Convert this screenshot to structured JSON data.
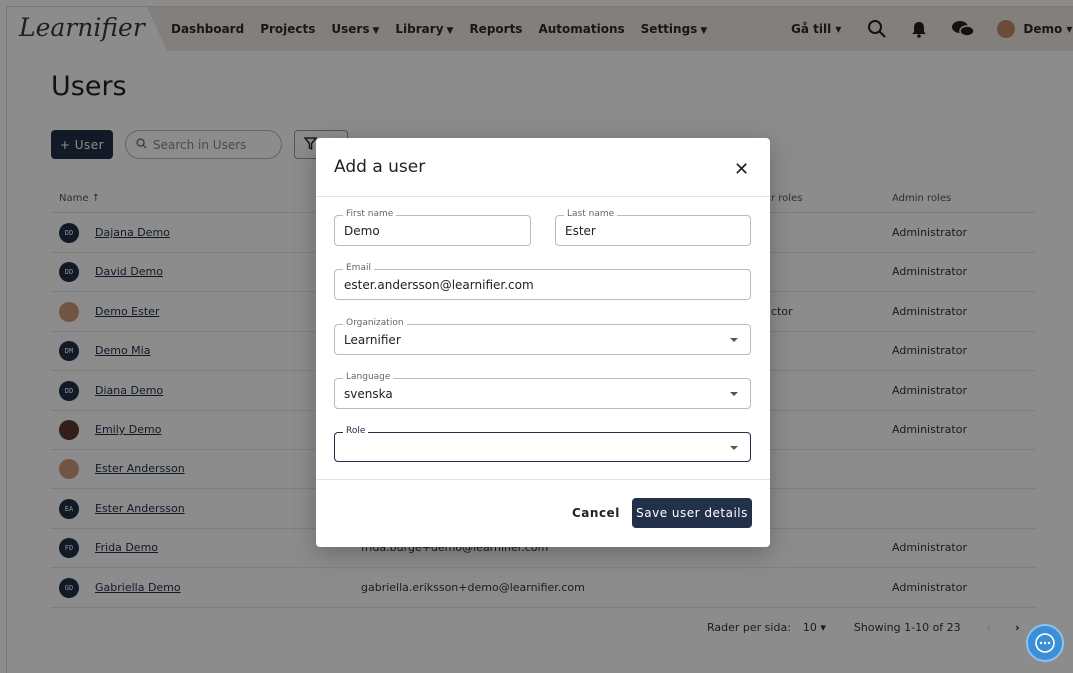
{
  "nav": {
    "logo": "Learnifier",
    "menu": [
      {
        "label": "Dashboard",
        "caret": false
      },
      {
        "label": "Projects",
        "caret": false
      },
      {
        "label": "Users",
        "caret": true
      },
      {
        "label": "Library",
        "caret": true
      },
      {
        "label": "Reports",
        "caret": false
      },
      {
        "label": "Automations",
        "caret": false
      },
      {
        "label": "Settings",
        "caret": true
      }
    ],
    "goto": "Gå till ▾",
    "user": "Demo ▾"
  },
  "page": {
    "title": "Users",
    "add_button": "+ User",
    "search_placeholder": "Search in Users"
  },
  "table": {
    "headers": {
      "name": "Name ↑",
      "user_roles": "r roles",
      "admin_roles": "Admin roles"
    },
    "rows": [
      {
        "initials": "DD",
        "name": "Dajana Demo",
        "email": "",
        "user_role": "",
        "admin_role": "Administrator",
        "photo": false
      },
      {
        "initials": "DD",
        "name": "David Demo",
        "email": "",
        "user_role": "",
        "admin_role": "Administrator",
        "photo": false
      },
      {
        "initials": "",
        "name": "Demo Ester",
        "email": "",
        "user_role": "ctor",
        "admin_role": "Administrator",
        "photo": true
      },
      {
        "initials": "DM",
        "name": "Demo Mia",
        "email": "",
        "user_role": "",
        "admin_role": "Administrator",
        "photo": false
      },
      {
        "initials": "DD",
        "name": "Diana Demo",
        "email": "",
        "user_role": "",
        "admin_role": "Administrator",
        "photo": false
      },
      {
        "initials": "",
        "name": "Emily Demo",
        "email": "",
        "user_role": "",
        "admin_role": "Administrator",
        "photo": true
      },
      {
        "initials": "",
        "name": "Ester Andersson",
        "email": "",
        "user_role": "",
        "admin_role": "",
        "photo": true
      },
      {
        "initials": "EA",
        "name": "Ester Andersson",
        "email": "",
        "user_role": "",
        "admin_role": "",
        "photo": false
      },
      {
        "initials": "FD",
        "name": "Frida Demo",
        "email": "frida.burge+demo@learnifier.com",
        "user_role": "",
        "admin_role": "Administrator",
        "photo": false
      },
      {
        "initials": "GD",
        "name": "Gabriella Demo",
        "email": "gabriella.eriksson+demo@learnifier.com",
        "user_role": "",
        "admin_role": "Administrator",
        "photo": false
      }
    ]
  },
  "pager": {
    "rows_label": "Rader per sida:",
    "rows_value": "10 ▾",
    "showing": "Showing 1-10 of 23",
    "prev": "‹",
    "next": "›"
  },
  "modal": {
    "title": "Add a user",
    "close": "✕",
    "first_name": {
      "label": "First name",
      "value": "Demo"
    },
    "last_name": {
      "label": "Last name",
      "value": "Ester"
    },
    "email": {
      "label": "Email",
      "value": "ester.andersson@learnifier.com"
    },
    "organization": {
      "label": "Organization",
      "value": "Learnifier"
    },
    "language": {
      "label": "Language",
      "value": "svenska"
    },
    "role": {
      "label": "Role",
      "value": ""
    },
    "cancel": "Cancel",
    "save": "Save user details"
  }
}
